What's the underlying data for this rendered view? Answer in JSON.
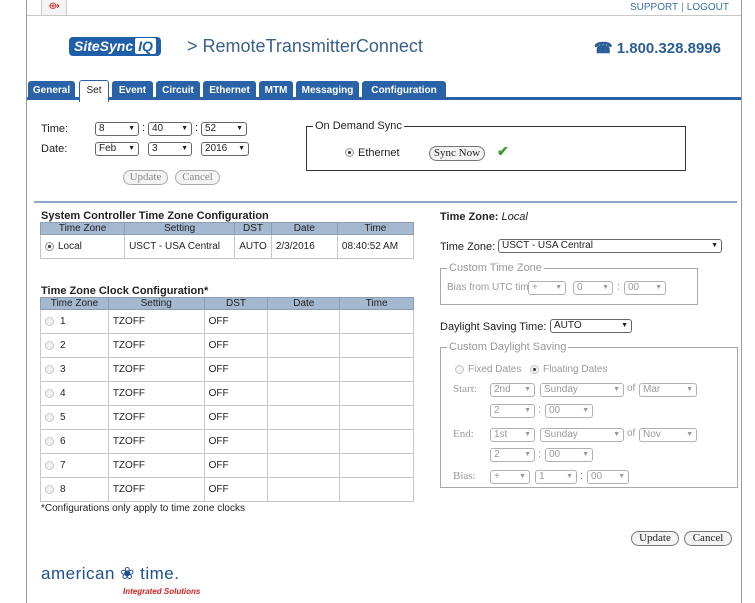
{
  "top": {
    "support": "SUPPORT",
    "separator": "|",
    "logout": "LOGOUT"
  },
  "header": {
    "logo_main": "SiteSync",
    "logo_iq": "IQ",
    "title": "> RemoteTransmitterConnect",
    "phone": "☎ 1.800.328.8996"
  },
  "tabs": [
    "General",
    "Set",
    "Event",
    "Circuit",
    "Ethernet",
    "MTM",
    "Messaging",
    "Configuration"
  ],
  "time_form": {
    "time_label": "Time:",
    "date_label": "Date:",
    "hour": "8",
    "minute": "40",
    "second": "52",
    "month": "Feb",
    "day": "3",
    "year": "2016",
    "colon": ":",
    "update": "Update",
    "cancel": "Cancel"
  },
  "on_demand": {
    "legend": "On Demand Sync",
    "option": "Ethernet",
    "button": "Sync Now"
  },
  "sys_tz": {
    "title": "System Controller Time Zone Configuration",
    "headers": [
      "Time Zone",
      "Setting",
      "DST",
      "Date",
      "Time"
    ],
    "row": {
      "zone": "Local",
      "setting": "USCT - USA Central",
      "dst": "AUTO",
      "date": "2/3/2016",
      "time": "08:40:52 AM"
    }
  },
  "clock_cfg": {
    "title": "Time Zone Clock Configuration*",
    "headers": [
      "Time Zone",
      "Setting",
      "DST",
      "Date",
      "Time"
    ],
    "rows": [
      {
        "zone": "1",
        "setting": "TZOFF",
        "dst": "OFF"
      },
      {
        "zone": "2",
        "setting": "TZOFF",
        "dst": "OFF"
      },
      {
        "zone": "3",
        "setting": "TZOFF",
        "dst": "OFF"
      },
      {
        "zone": "4",
        "setting": "TZOFF",
        "dst": "OFF"
      },
      {
        "zone": "5",
        "setting": "TZOFF",
        "dst": "OFF"
      },
      {
        "zone": "6",
        "setting": "TZOFF",
        "dst": "OFF"
      },
      {
        "zone": "7",
        "setting": "TZOFF",
        "dst": "OFF"
      },
      {
        "zone": "8",
        "setting": "TZOFF",
        "dst": "OFF"
      }
    ],
    "footnote": "*Configurations only apply to time zone clocks"
  },
  "right": {
    "tz_heading": "Time Zone:",
    "tz_heading_value": "Local",
    "tz_label": "Time Zone:",
    "tz_value": "USCT - USA Central",
    "custom_tz_legend": "Custom Time Zone",
    "bias_label": "Bias from UTC time:",
    "bias_sign": "+",
    "bias_hours": "0",
    "bias_minutes": "00",
    "dst_label": "Daylight Saving Time:",
    "dst_value": "AUTO",
    "custom_dst_legend": "Custom Daylight Saving",
    "fixed": "Fixed Dates",
    "floating": "Floating Dates",
    "start_label": "Start:",
    "start_week": "2nd",
    "start_day": "Sunday",
    "of": "of",
    "start_month": "Mar",
    "start_hour": "2",
    "start_min": "00",
    "end_label": "End:",
    "end_week": "1st",
    "end_day": "Sunday",
    "end_month": "Nov",
    "end_hour": "2",
    "end_min": "00",
    "bias2_label": "Bias:",
    "bias2_sign": "+",
    "bias2_hours": "1",
    "bias2_min": "00"
  },
  "bottom": {
    "update": "Update",
    "cancel": "Cancel"
  },
  "brand": {
    "name": "american ❀ time.",
    "tagline": "Integrated Solutions"
  },
  "colors": {
    "tab_blue": "#2a62a8",
    "header_blue": "#3a5f8a",
    "check_green": "#3c9b2e",
    "table_header": "#a4b8d0"
  }
}
